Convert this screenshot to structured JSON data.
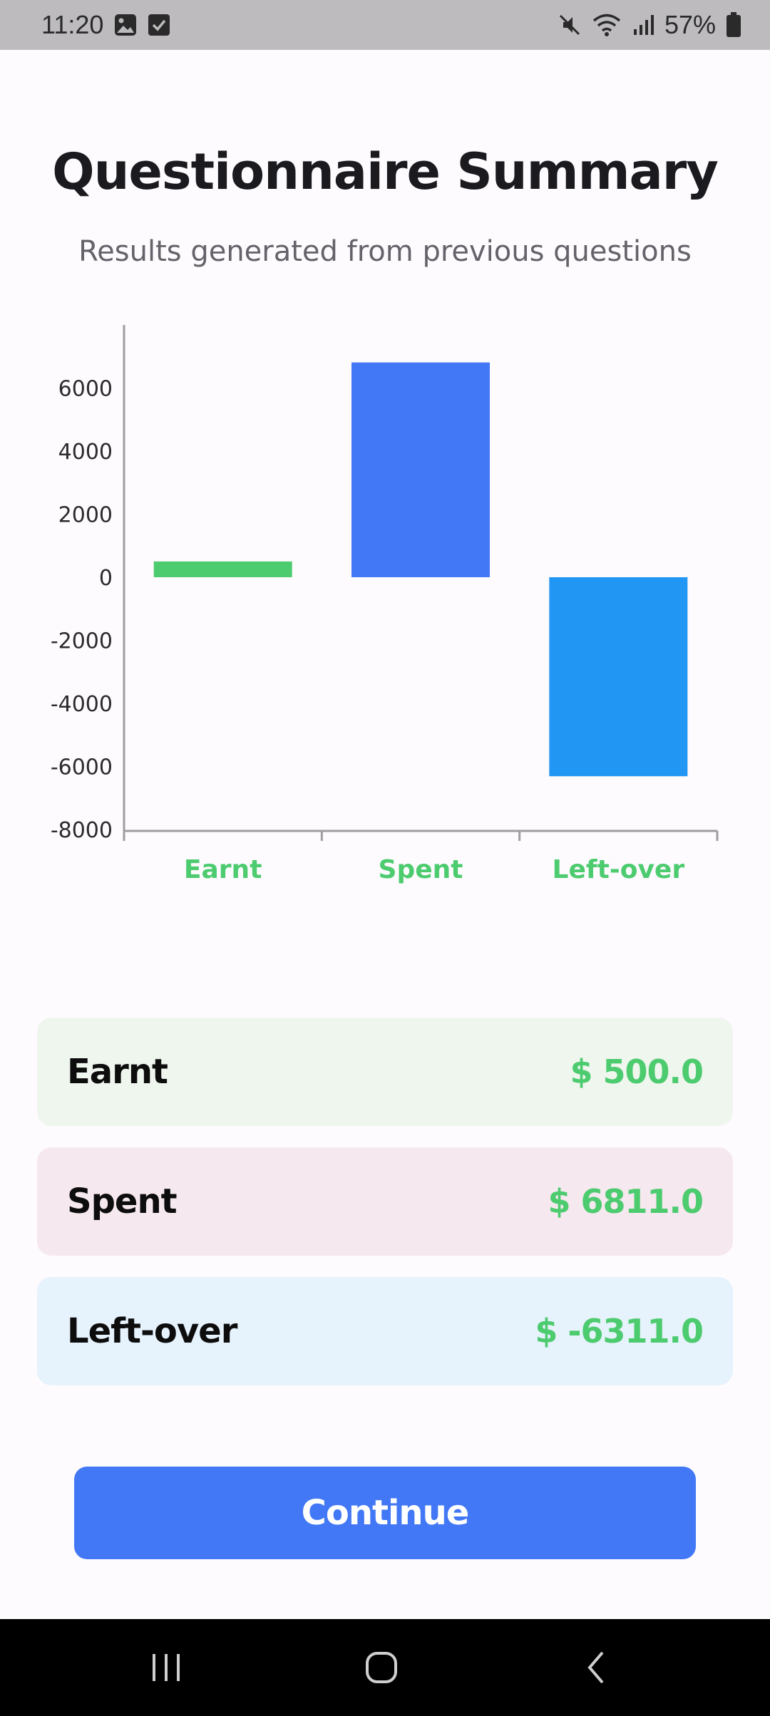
{
  "status_bar": {
    "time": "11:20",
    "left_icons": [
      "image-icon",
      "checkbox-icon"
    ],
    "right_icons": [
      "mute-icon",
      "wifi-icon",
      "signal-icon",
      "battery-icon"
    ],
    "battery": "57%"
  },
  "header": {
    "title": "Questionnaire Summary",
    "subtitle": "Results generated from previous questions"
  },
  "chart_data": {
    "type": "bar",
    "categories": [
      "Earnt",
      "Spent",
      "Left-over"
    ],
    "values": [
      500.0,
      6811.0,
      -6311.0
    ],
    "colors": [
      "#4CCB6F",
      "#4278F5",
      "#2196F3"
    ],
    "y_ticks": [
      "6000",
      "4000",
      "2000",
      "0",
      "-2000",
      "-4000",
      "-6000",
      "-8000"
    ],
    "ylim": [
      -8000,
      8000
    ],
    "grid": false
  },
  "summary": {
    "cards": [
      {
        "label": "Earnt",
        "value": "$ 500.0",
        "bg": "#EFF6EE"
      },
      {
        "label": "Spent",
        "value": "$ 6811.0",
        "bg": "#F6E8EF"
      },
      {
        "label": "Left-over",
        "value": "$ -6311.0",
        "bg": "#E6F2FC"
      }
    ]
  },
  "actions": {
    "continue_label": "Continue"
  },
  "nav_bar": {
    "buttons": [
      "recent-apps-icon",
      "home-icon",
      "back-icon"
    ]
  },
  "theme": {
    "accent": "#4278F5",
    "positive_text": "#4CCB6F",
    "background": "#FEFBFE"
  }
}
